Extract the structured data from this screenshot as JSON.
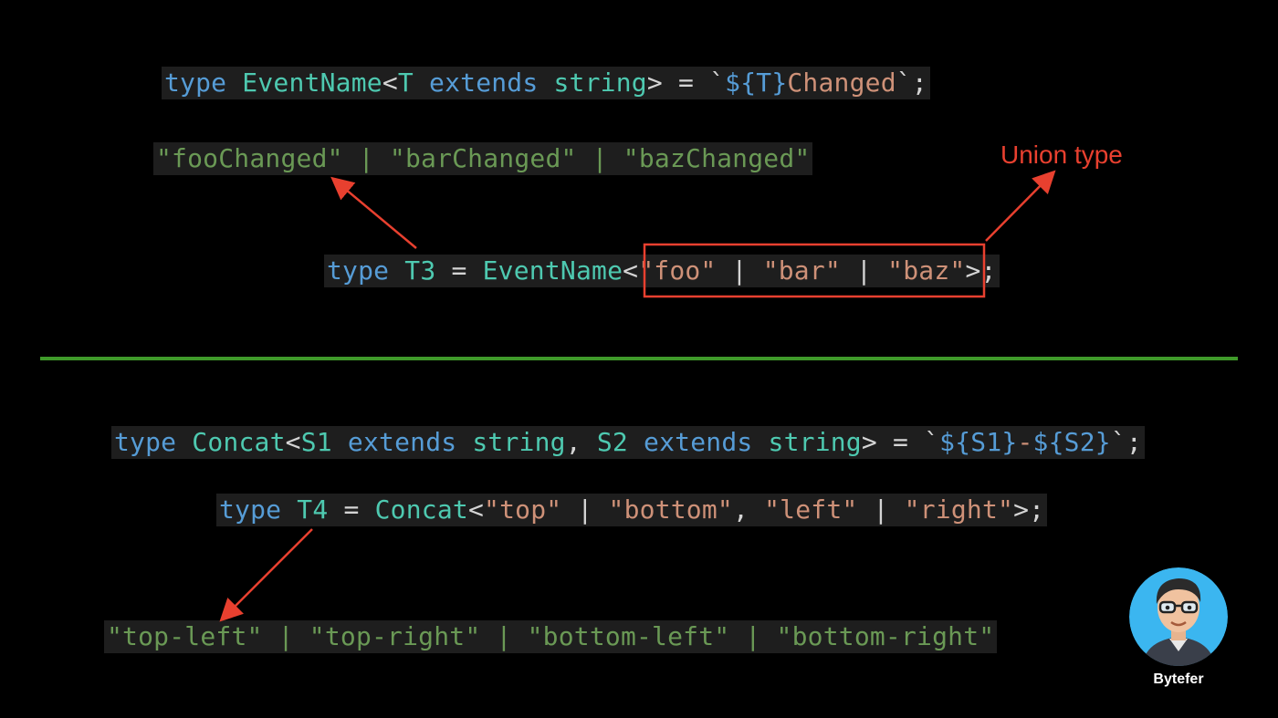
{
  "slide": {
    "upper": {
      "definition": [
        "type",
        "EventName",
        "<",
        "T",
        "extends",
        "string",
        "> = `",
        "${T}",
        "Changed",
        "`;"
      ],
      "result": [
        "\"fooChanged\"",
        " | ",
        "\"barChanged\"",
        " | ",
        "\"bazChanged\""
      ],
      "usage": [
        "type",
        "T3",
        " = ",
        "EventName",
        "<",
        "\"foo\"",
        " | ",
        "\"bar\"",
        " | ",
        "\"baz\"",
        ">;"
      ],
      "annotation": "Union type"
    },
    "lower": {
      "definition": [
        "type",
        "Concat",
        "<",
        "S1",
        "extends",
        "string",
        ", ",
        "S2",
        "extends",
        "string",
        "> = `",
        "${S1}",
        "-",
        "${S2}",
        "`;"
      ],
      "usage": [
        "type",
        "T4",
        " = ",
        "Concat",
        "<",
        "\"top\"",
        " | ",
        "\"bottom\"",
        ", ",
        "\"left\"",
        " | ",
        "\"right\"",
        ">;"
      ],
      "result": [
        "\"top-left\"",
        " | ",
        "\"top-right\"",
        " | ",
        "\"bottom-left\"",
        " | ",
        "\"bottom-right\""
      ]
    },
    "brand": "Bytefer",
    "colors": {
      "keyword": "#569cd6",
      "type_name": "#4ec9b0",
      "string": "#ce9178",
      "literal_result": "#6a9955",
      "annotation": "#e8402f",
      "divider": "#3f9a2a"
    }
  }
}
